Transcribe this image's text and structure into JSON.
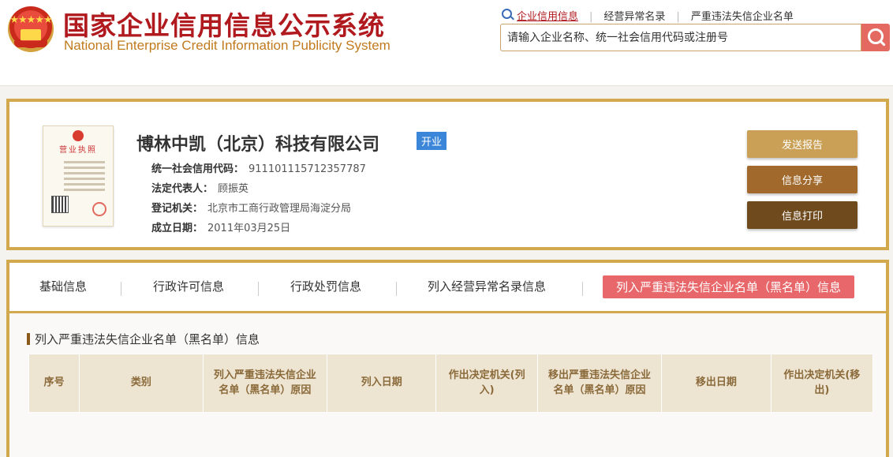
{
  "header": {
    "title_cn": "国家企业信用信息公示系统",
    "title_en": "National Enterprise Credit Information Publicity System",
    "top_links": [
      "企业信用信息",
      "经营异常名录",
      "严重违法失信企业名单"
    ],
    "search_placeholder": "请输入企业名称、统一社会信用代码或注册号"
  },
  "license": {
    "title": "营业执照"
  },
  "company": {
    "name": "博林中凯（北京）科技有限公司",
    "status": "开业",
    "fields": [
      {
        "label": "统一社会信用代码：",
        "value": "911101115712357787"
      },
      {
        "label": "法定代表人：",
        "value": "顾振英"
      },
      {
        "label": "登记机关：",
        "value": "北京市工商行政管理局海淀分局"
      },
      {
        "label": "成立日期：",
        "value": "2011年03月25日"
      }
    ]
  },
  "actions": [
    {
      "label": "发送报告",
      "color": "#c9a055"
    },
    {
      "label": "信息分享",
      "color": "#a16a2c"
    },
    {
      "label": "信息打印",
      "color": "#6e4a1c"
    }
  ],
  "tabs": [
    {
      "label": "基础信息",
      "active": false
    },
    {
      "label": "行政许可信息",
      "active": false
    },
    {
      "label": "行政处罚信息",
      "active": false
    },
    {
      "label": "列入经营异常名录信息",
      "active": false
    },
    {
      "label": "列入严重违法失信企业名单（黑名单）信息",
      "active": true
    }
  ],
  "section": {
    "title": "列入严重违法失信企业名单（黑名单）信息",
    "columns": [
      "序号",
      "类别",
      "列入严重违法失信企业名单（黑名单）原因",
      "列入日期",
      "作出决定机关(列入)",
      "移出严重违法失信企业名单（黑名单）原因",
      "移出日期",
      "作出决定机关(移出)"
    ]
  },
  "colors": {
    "brand_red": "#b0191e",
    "gold": "#d2a94d",
    "badge_blue": "#3b86d8",
    "active_tab": "#e8676a"
  },
  "icons": [
    "national-emblem-icon",
    "search-icon"
  ]
}
